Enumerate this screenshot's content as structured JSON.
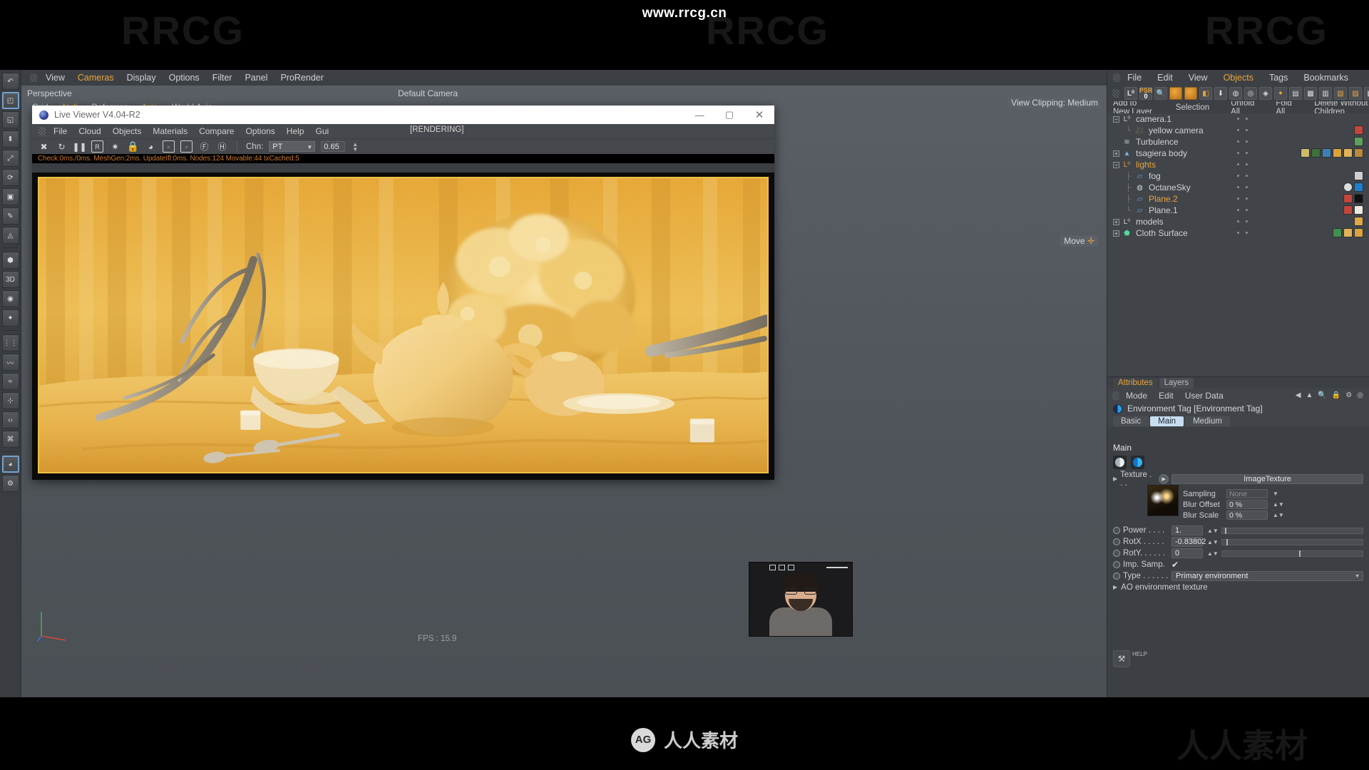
{
  "page": {
    "site_url": "www.rrcg.cn",
    "watermark_latin": "RRCG",
    "watermark_cn": "人人素材",
    "footer_brand": "人人素材",
    "footer_mark": "AG"
  },
  "viewport": {
    "menu": [
      "View",
      "Cameras",
      "Display",
      "Options",
      "Filter",
      "Panel",
      "ProRender"
    ],
    "menu_highlight": "Cameras",
    "perspective_label": "Perspective",
    "default_camera_label": "Default Camera",
    "view_clipping": "View Clipping: Medium",
    "move_label": "Move",
    "fps": "FPS : 15.9",
    "modes": [
      {
        "label": "Grid",
        "active": false
      },
      {
        "label": "Null",
        "active": true
      },
      {
        "label": "Deformer",
        "active": false
      },
      {
        "label": "Axis",
        "active": true
      },
      {
        "label": "World Axis",
        "active": false
      }
    ]
  },
  "live_viewer": {
    "title": "Live Viewer V4.04-R2",
    "window_buttons": [
      "minimize-button",
      "maximize-button",
      "close-button"
    ],
    "menu": [
      "File",
      "Cloud",
      "Objects",
      "Materials",
      "Compare",
      "Options",
      "Help",
      "Gui"
    ],
    "render_state": "[RENDERING]",
    "toolbar_icons": [
      "stop-render-icon",
      "restart-render-icon",
      "pause-render-icon",
      "region-render-icon",
      "settings-gear-icon",
      "lock-icon",
      "material-sphere-icon",
      "render-region-icon",
      "render-region-alt-icon",
      "focus-pick-icon",
      "highlight-pick-icon"
    ],
    "channel_label": "Chn:",
    "channel_value": "PT",
    "exposure_value": "0.65",
    "status": "Check:0ms./0ms. MeshGen:2ms. UpdateIfl:0ms. Nodes:124 Movable:44 txCached:5"
  },
  "object_manager": {
    "menu": [
      "File",
      "Edit",
      "View",
      "Objects",
      "Tags",
      "Bookmarks"
    ],
    "menu_highlight": "Objects",
    "toolbar_icons": [
      "layer-zero-icon",
      "psr-icon",
      "search-object-icon",
      "octane-tag-icon",
      "octane-object-icon",
      "octane-camera-icon",
      "move-down-icon",
      "octane-render-icon",
      "octane-settings-icon",
      "octane-node-icon",
      "octane-light-icon",
      "octane-texture-icon",
      "octane-material-icon",
      "layout-a-icon",
      "layout-b-icon",
      "layout-c-icon",
      "layout-d-icon"
    ],
    "layer_actions": [
      "Add to New Layer",
      "Selection",
      "Unfold All",
      "Fold All",
      "Delete Without Children"
    ],
    "tree": [
      {
        "name": "camera.1",
        "icon": "null-object-icon",
        "indent": 0,
        "expander": "minus",
        "highlight": false
      },
      {
        "name": "yellow camera",
        "icon": "camera-icon",
        "indent": 1,
        "expander": "none",
        "highlight": false
      },
      {
        "name": "Turbulence",
        "icon": "turbulence-icon",
        "indent": 0,
        "expander": "none",
        "highlight": false
      },
      {
        "name": "tsagiera body",
        "icon": "cone-object-icon",
        "indent": 0,
        "expander": "plus",
        "highlight": false
      },
      {
        "name": "lights",
        "icon": "null-object-icon",
        "indent": 0,
        "expander": "minus",
        "highlight": true
      },
      {
        "name": "fog",
        "icon": "plane-object-icon",
        "indent": 1,
        "expander": "none",
        "highlight": false
      },
      {
        "name": "OctaneSky",
        "icon": "octane-sky-icon",
        "indent": 1,
        "expander": "none",
        "highlight": false
      },
      {
        "name": "Plane.2",
        "icon": "plane-object-icon",
        "indent": 1,
        "expander": "none",
        "highlight": true
      },
      {
        "name": "Plane.1",
        "icon": "plane-object-icon",
        "indent": 1,
        "expander": "none",
        "highlight": false
      },
      {
        "name": "models",
        "icon": "null-object-icon",
        "indent": 0,
        "expander": "plus",
        "highlight": false
      },
      {
        "name": "Cloth Surface",
        "icon": "cloth-surface-icon",
        "indent": 0,
        "expander": "plus",
        "highlight": false
      }
    ]
  },
  "attributes": {
    "tabs": [
      {
        "label": "Attributes",
        "active": true
      },
      {
        "label": "Layers",
        "active": false
      }
    ],
    "menu": [
      "Mode",
      "Edit",
      "User Data"
    ],
    "menu_icons": [
      "back-arrow-icon",
      "up-arrow-icon",
      "search-icon",
      "lock-icon",
      "gear-icon",
      "pin-icon"
    ],
    "header": "Environment Tag [Environment Tag]",
    "sub_tabs": [
      {
        "label": "Basic",
        "active": false
      },
      {
        "label": "Main",
        "active": true
      },
      {
        "label": "Medium",
        "active": false
      }
    ],
    "section_title": "Main",
    "swatches": [
      "environment-swatch-grey",
      "environment-swatch-blue"
    ],
    "texture_row": {
      "label": "Texture . . .",
      "value": "ImageTexture"
    },
    "sampling": {
      "label": "Sampling",
      "value": "None"
    },
    "blur_offset": {
      "label": "Blur Offset",
      "value": "0 %"
    },
    "blur_scale": {
      "label": "Blur Scale",
      "value": "0 %"
    },
    "params": [
      {
        "label": "Power . . . .",
        "value": "1.",
        "slider": 0.02
      },
      {
        "label": "RotX . . . . .",
        "value": "-0.83802",
        "slider": 0.03
      },
      {
        "label": "RotY. . . . . .",
        "value": "0",
        "slider": 0.55
      }
    ],
    "imp_samp": {
      "label": "Imp. Samp.",
      "checked": true
    },
    "type_row": {
      "label": "Type . . . . . .",
      "value": "Primary environment"
    },
    "ao_row": "AO environment texture",
    "help_label": "HELP"
  },
  "webcam": {
    "label": "webcam-overlay"
  }
}
